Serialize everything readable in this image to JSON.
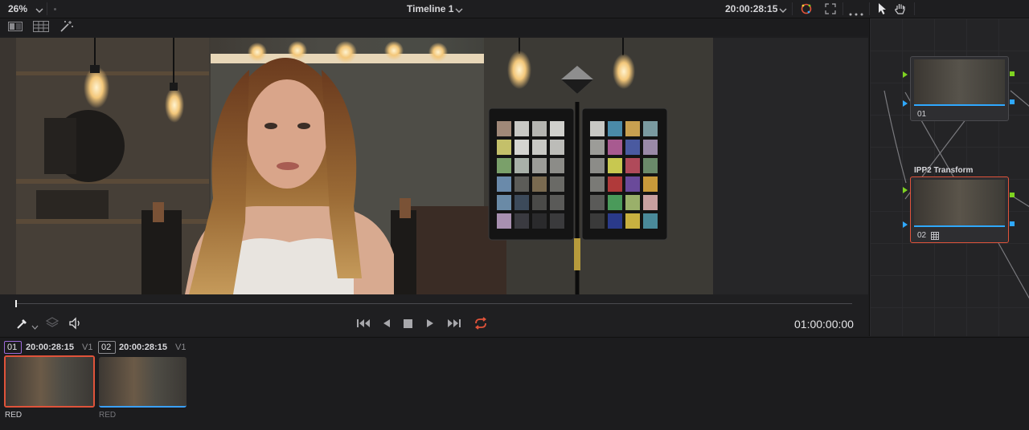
{
  "viewer": {
    "zoom": "26%",
    "timeline_title": "Timeline 1",
    "source_timecode": "20:00:28:15",
    "playhead_timecode": "01:00:00:00"
  },
  "nodes": [
    {
      "number": "01",
      "label": ""
    },
    {
      "number": "02",
      "label": "IPP2 Transform"
    }
  ],
  "clips": [
    {
      "number": "01",
      "timecode": "20:00:28:15",
      "track": "V1",
      "codec": "RED",
      "selected": true
    },
    {
      "number": "02",
      "timecode": "20:00:28:15",
      "track": "V1",
      "codec": "RED",
      "selected": false
    }
  ],
  "colors": {
    "accent_red": "#e0533a",
    "playhead_white": "#f2f2f2",
    "node_port_green": "#7ed321",
    "node_port_blue": "#2fa8ff",
    "clip_outline_blue": "#3aa0ff",
    "clip_number_highlight": "#9c6bd8"
  }
}
